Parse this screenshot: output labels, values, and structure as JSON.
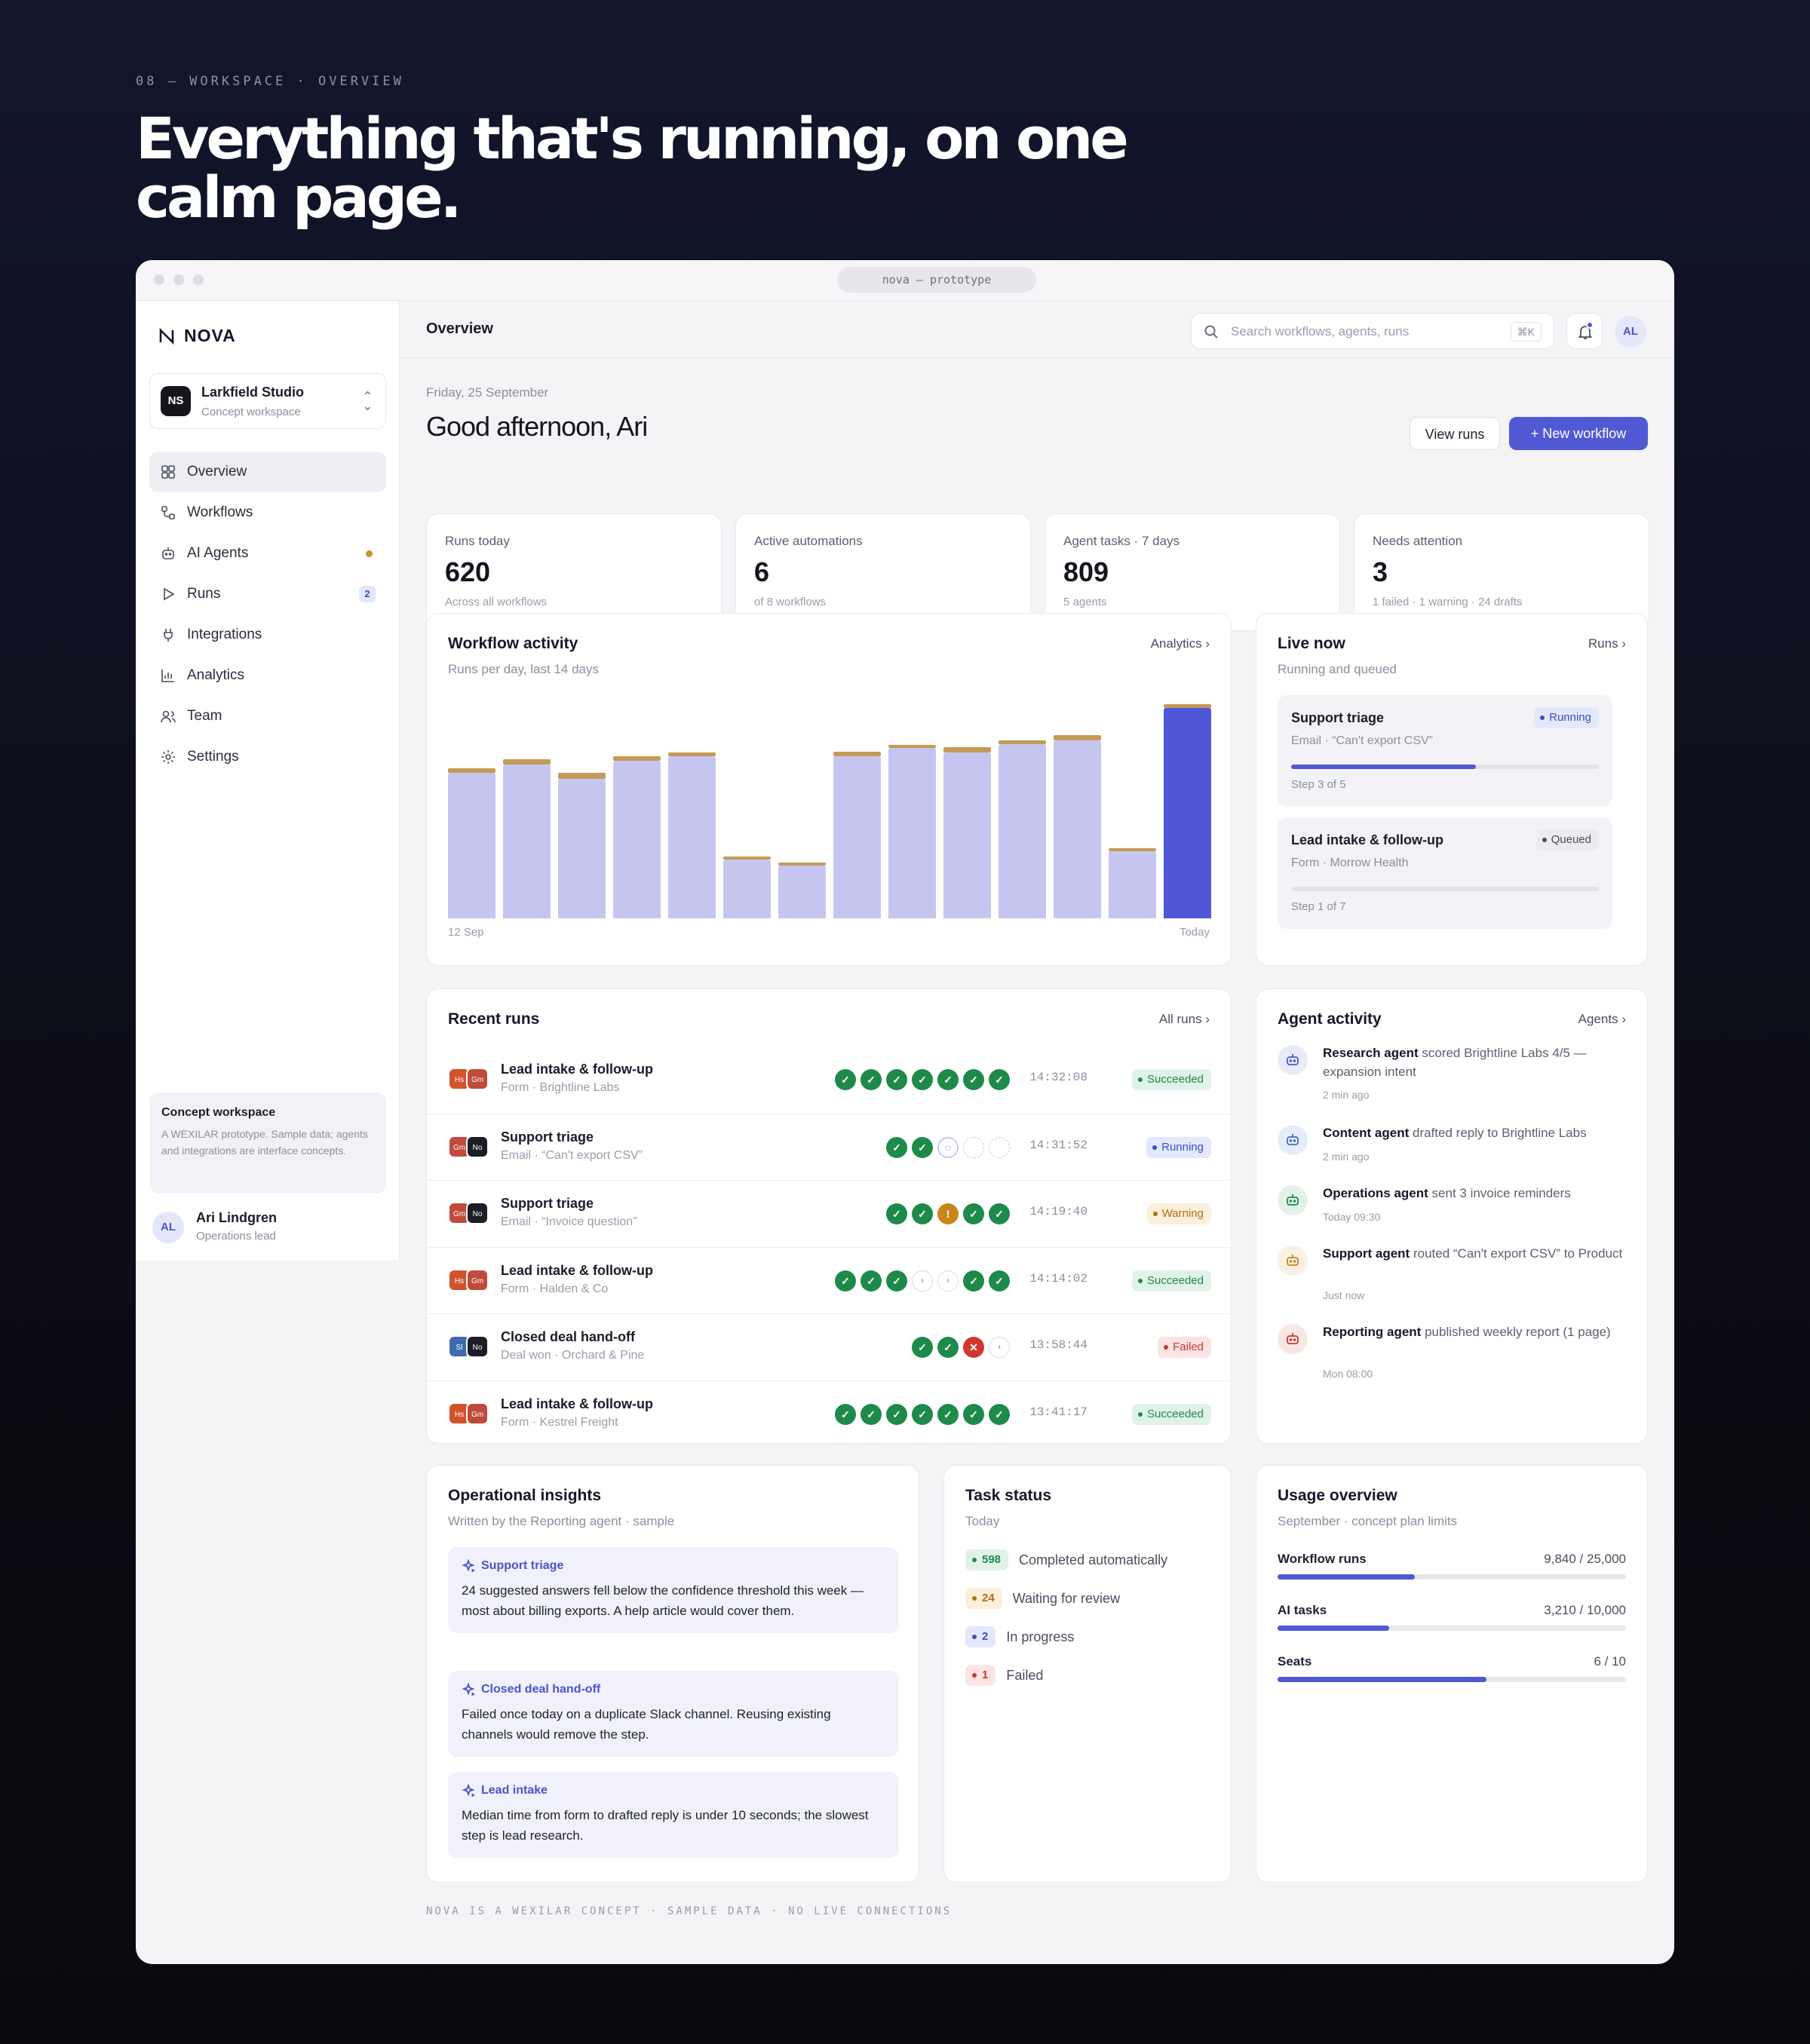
{
  "eyebrow": "08 — WORKSPACE · OVERVIEW",
  "hero_title": "Everything that's running, on one calm page.",
  "window_title": "nova — prototype",
  "sidebar": {
    "brand": "NOVA",
    "workspace": {
      "initials": "NS",
      "name": "Larkfield Studio",
      "subtitle": "Concept workspace"
    },
    "items": [
      {
        "label": "Overview",
        "icon": "grid-icon",
        "active": true
      },
      {
        "label": "Workflows",
        "icon": "workflow-icon"
      },
      {
        "label": "AI Agents",
        "icon": "robot-icon",
        "dot": true
      },
      {
        "label": "Runs",
        "icon": "play-icon",
        "badge": "2"
      },
      {
        "label": "Integrations",
        "icon": "plug-icon"
      },
      {
        "label": "Analytics",
        "icon": "chart-icon"
      },
      {
        "label": "Team",
        "icon": "users-icon"
      },
      {
        "label": "Settings",
        "icon": "gear-icon"
      }
    ],
    "concept": {
      "title": "Concept workspace",
      "text": "A WEXILAR prototype. Sample data; agents and integrations are interface concepts."
    },
    "user": {
      "initials": "AL",
      "name": "Ari Lindgren",
      "role": "Operations lead"
    }
  },
  "topbar": {
    "breadcrumb": "Overview",
    "search_placeholder": "Search workflows, agents, runs",
    "shortcut": "⌘K",
    "avatar": "AL"
  },
  "header": {
    "date": "Friday, 25 September",
    "greeting": "Good afternoon, Ari",
    "view_runs": "View runs",
    "new_workflow": "New workflow"
  },
  "kpis": [
    {
      "label": "Runs today",
      "value": "620",
      "sub": "Across all workflows"
    },
    {
      "label": "Active automations",
      "value": "6",
      "sub": "of 8 workflows"
    },
    {
      "label": "Agent tasks · 7 days",
      "value": "809",
      "sub": "5 agents"
    },
    {
      "label": "Needs attention",
      "value": "3",
      "sub": "1 failed · 1 warning · 24 drafts"
    }
  ],
  "activity": {
    "title": "Workflow activity",
    "subtitle": "Runs per day, last 14 days",
    "link": "Analytics",
    "x_start": "12 Sep",
    "x_end": "Today"
  },
  "chart_data": {
    "type": "bar",
    "title": "Workflow activity",
    "subtitle": "Runs per day, last 14 days",
    "categories": [
      "12 Sep",
      "",
      "",
      "",
      "",
      "",
      "",
      "",
      "",
      "",
      "",
      "",
      "",
      "Today"
    ],
    "series": [
      {
        "values": [
          360,
          380,
          345,
          390,
          400,
          145,
          130,
          400,
          420,
          410,
          430,
          440,
          165,
          520
        ]
      }
    ],
    "cap_series": [
      {
        "values": [
          10,
          12,
          15,
          10,
          10,
          6,
          6,
          12,
          8,
          12,
          10,
          12,
          6,
          8
        ]
      }
    ],
    "highlight_color": "#4f57d6",
    "bar_color": "#c5c6f0",
    "cap_color": "#c49a58",
    "ylim": [
      0,
      540
    ],
    "grid": false
  },
  "live": {
    "title": "Live now",
    "subtitle": "Running and queued",
    "link": "Runs",
    "items": [
      {
        "name": "Support triage",
        "sub": "Email · “Can't export CSV”",
        "status": "Running",
        "step": "Step 3 of 5",
        "progress": 0.6
      },
      {
        "name": "Lead intake & follow-up",
        "sub": "Form · Morrow Health",
        "status": "Queued",
        "step": "Step 1 of 7",
        "progress": 0
      }
    ]
  },
  "recent": {
    "title": "Recent runs",
    "link": "All runs",
    "rows": [
      {
        "name": "Lead intake & follow-up",
        "sub": "Form · Brightline Labs",
        "apps": [
          "Hs",
          "Gm"
        ],
        "steps": [
          "ok",
          "ok",
          "ok",
          "ok",
          "ok",
          "ok",
          "ok"
        ],
        "time": "14:32:08",
        "status": "Succeeded"
      },
      {
        "name": "Support triage",
        "sub": "Email · “Can't export CSV”",
        "apps": [
          "Gm",
          "No"
        ],
        "steps": [
          "ok",
          "ok",
          "run",
          "pend",
          "pend"
        ],
        "time": "14:31:52",
        "status": "Running"
      },
      {
        "name": "Support triage",
        "sub": "Email · “Invoice question”",
        "apps": [
          "Gm",
          "No"
        ],
        "steps": [
          "ok",
          "ok",
          "warn",
          "ok",
          "ok"
        ],
        "time": "14:19:40",
        "status": "Warning"
      },
      {
        "name": "Lead intake & follow-up",
        "sub": "Form · Halden & Co",
        "apps": [
          "Hs",
          "Gm"
        ],
        "steps": [
          "ok",
          "ok",
          "ok",
          "skip",
          "skip",
          "ok",
          "ok"
        ],
        "time": "14:14:02",
        "status": "Succeeded"
      },
      {
        "name": "Closed deal hand-off",
        "sub": "Deal won · Orchard & Pine",
        "apps": [
          "Sl",
          "No"
        ],
        "steps": [
          "ok",
          "ok",
          "fail",
          "skip"
        ],
        "time": "13:58:44",
        "status": "Failed"
      },
      {
        "name": "Lead intake & follow-up",
        "sub": "Form · Kestrel Freight",
        "apps": [
          "Hs",
          "Gm"
        ],
        "steps": [
          "ok",
          "ok",
          "ok",
          "ok",
          "ok",
          "ok",
          "ok"
        ],
        "time": "13:41:17",
        "status": "Succeeded"
      }
    ]
  },
  "agents": {
    "title": "Agent activity",
    "link": "Agents",
    "items": [
      {
        "agent": "Research agent",
        "text": "scored Brightline Labs 4/5 — expansion intent",
        "time": "2 min ago",
        "color": "#5058d4"
      },
      {
        "agent": "Content agent",
        "text": "drafted reply to Brightline Labs",
        "time": "2 min ago",
        "color": "#3d6fc6"
      },
      {
        "agent": "Operations agent",
        "text": "sent 3 invoice reminders",
        "time": "Today 09:30",
        "color": "#1f8a4c"
      },
      {
        "agent": "Support agent",
        "text": "routed “Can't export CSV” to Product",
        "time": "Just now",
        "color": "#c98618"
      },
      {
        "agent": "Reporting agent",
        "text": "published weekly report (1 page)",
        "time": "Mon 08:00",
        "color": "#c8372d"
      }
    ]
  },
  "insights": {
    "title": "Operational insights",
    "subtitle": "Written by the Reporting agent · sample",
    "items": [
      {
        "heading": "Support triage",
        "body": "24 suggested answers fell below the confidence threshold this week — most about billing exports. A help article would cover them."
      },
      {
        "heading": "Closed deal hand-off",
        "body": "Failed once today on a duplicate Slack channel. Reusing existing channels would remove the step."
      },
      {
        "heading": "Lead intake",
        "body": "Median time from form to drafted reply is under 10 seconds; the slowest step is lead research."
      }
    ]
  },
  "tasks": {
    "title": "Task status",
    "subtitle": "Today",
    "items": [
      {
        "count": "598",
        "label": "Completed automatically",
        "kind": "ok"
      },
      {
        "count": "24",
        "label": "Waiting for review",
        "kind": "warn"
      },
      {
        "count": "2",
        "label": "In progress",
        "kind": "run"
      },
      {
        "count": "1",
        "label": "Failed",
        "kind": "fail"
      }
    ]
  },
  "usage": {
    "title": "Usage overview",
    "subtitle": "September · concept plan limits",
    "items": [
      {
        "label": "Workflow runs",
        "value": "9,840 / 25,000",
        "fraction": 0.394
      },
      {
        "label": "AI tasks",
        "value": "3,210 / 10,000",
        "fraction": 0.321
      },
      {
        "label": "Seats",
        "value": "6 / 10",
        "fraction": 0.6
      }
    ]
  },
  "footer": "NOVA IS A WEXILAR CONCEPT · SAMPLE DATA · NO LIVE CONNECTIONS"
}
